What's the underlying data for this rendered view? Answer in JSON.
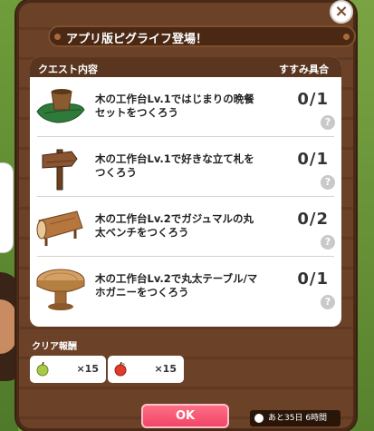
{
  "dialog": {
    "title": "アプリ版ピグライフ登場！",
    "close_symbol": "×",
    "column_quest": "クエスト内容",
    "column_progress": "すすみ具合"
  },
  "quests": [
    {
      "text": "木の工作台Lv.1ではじまりの晩餐セットをつくろう",
      "progress": "0/1",
      "icon": "bowl-on-leaf-icon"
    },
    {
      "text": "木の工作台Lv.1で好きな立て札をつくろう",
      "progress": "0/1",
      "icon": "signpost-icon"
    },
    {
      "text": "木の工作台Lv.2でガジュマルの丸太ベンチをつくろう",
      "progress": "0/2",
      "icon": "log-bench-icon"
    },
    {
      "text": "木の工作台Lv.2で丸太テーブル/マホガニーをつくろう",
      "progress": "0/1",
      "icon": "round-table-icon"
    }
  ],
  "help_symbol": "?",
  "rewards": {
    "label": "クリア報酬",
    "items": [
      {
        "icon": "green-fruit-icon",
        "qty": "×15",
        "color": "#a8c94a"
      },
      {
        "icon": "red-fruit-icon",
        "qty": "×15",
        "color": "#e23a2c"
      }
    ]
  },
  "ok_label": "OK",
  "timer_text": "あと35日 6時間",
  "colors": {
    "accent": "#f04566",
    "panel": "#6b4128",
    "header": "#5a3620"
  }
}
